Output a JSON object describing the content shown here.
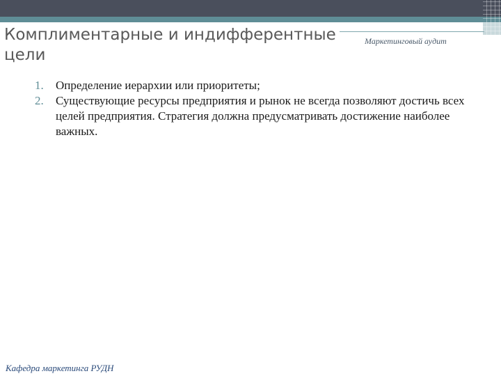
{
  "header": {
    "title": "Комплиментарные и индифферентные цели",
    "caption": "Маркетинговый аудит"
  },
  "content": {
    "items": [
      {
        "number": "1.",
        "text": "Определение иерархии или приоритеты;"
      },
      {
        "number": "2.",
        "text": "Существующие ресурсы  предприятия и рынок не всегда позволяют достичь всех целей предприятия. Стратегия должна предусматривать достижение наиболее важных."
      }
    ]
  },
  "footer": {
    "text": "Кафедра маркетинга РУДН"
  },
  "colors": {
    "top_bar": "#4a4f5c",
    "accent": "#5f8d96",
    "footer_text": "#2a4a7a"
  }
}
